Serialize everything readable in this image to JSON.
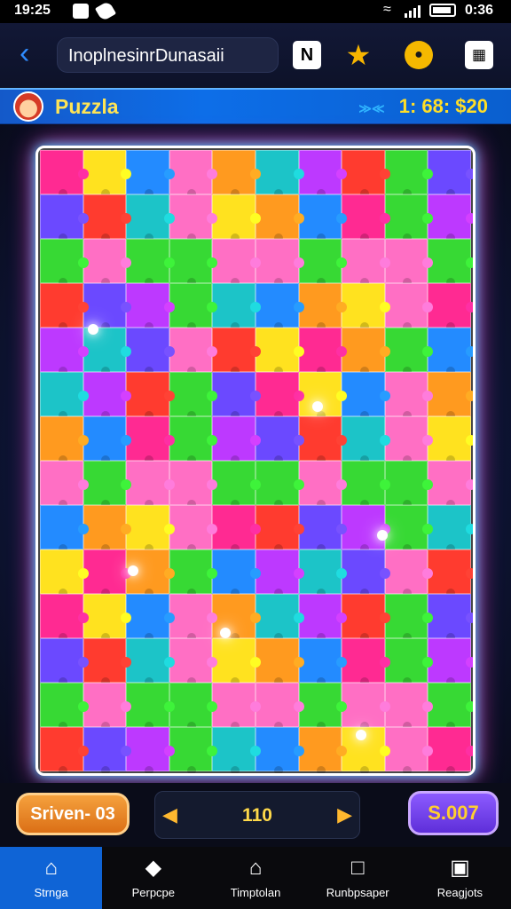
{
  "status": {
    "time": "19:25",
    "right": "0:36"
  },
  "appbar": {
    "url": "InoplnesinrDunasaii"
  },
  "header": {
    "title": "Puzzla",
    "score": "1: 68: $20"
  },
  "board": {
    "rows": 14,
    "cols": 10,
    "palette": [
      "#ff2a92",
      "#ff3b2f",
      "#ff9a1f",
      "#ffe21f",
      "#37d934",
      "#1cc4c8",
      "#238bff",
      "#6b49ff",
      "#bd39ff",
      "#ff6fc4"
    ]
  },
  "bottom": {
    "left_button": "Sriven- 03",
    "pager_value": "110",
    "pager_prev_icon": "chevron-left-icon",
    "pager_next_icon": "chevron-right-icon",
    "right_button": "S.007"
  },
  "tabs": [
    {
      "label": "Strnga",
      "icon": "home-icon",
      "active": true
    },
    {
      "label": "Perpcpe",
      "icon": "box-icon",
      "active": false
    },
    {
      "label": "Timptolan",
      "icon": "house-outline-icon",
      "active": false
    },
    {
      "label": "Runbpsaper",
      "icon": "folder-icon",
      "active": false
    },
    {
      "label": "Reagjots",
      "icon": "card-icon",
      "active": false
    }
  ]
}
